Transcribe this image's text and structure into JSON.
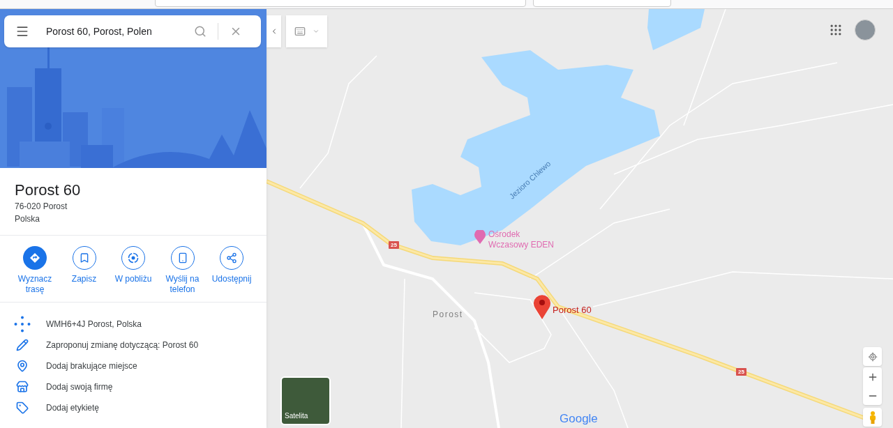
{
  "search": {
    "value": "Porost 60, Porost, Polen"
  },
  "place": {
    "title": "Porost 60",
    "address_lines": [
      "76-020 Porost",
      "Polska"
    ]
  },
  "actions": [
    {
      "label": "Wyznacz trasę",
      "kind": "route",
      "selected": true
    },
    {
      "label": "Zapisz",
      "kind": "save",
      "selected": false
    },
    {
      "label": "W pobliżu",
      "kind": "nearby",
      "selected": false
    },
    {
      "label": "Wyślij na telefon",
      "kind": "phone",
      "selected": false
    },
    {
      "label": "Udostępnij",
      "kind": "share",
      "selected": false
    }
  ],
  "details": [
    {
      "label": "WMH6+4J Porost, Polska",
      "kind": "pluscode"
    },
    {
      "label": "Zaproponuj zmianę dotyczącą: Porost 60",
      "kind": "edit"
    },
    {
      "label": "Dodaj brakujące miejsce",
      "kind": "addplace"
    },
    {
      "label": "Dodaj swoją firmę",
      "kind": "business"
    },
    {
      "label": "Dodaj etykietę",
      "kind": "label"
    }
  ],
  "map": {
    "lake_label": "Jezioro Chlewo",
    "poi_label": "Ośrodek Wczasowy EDEN",
    "village_label": "Porost",
    "pin_label": "Porost 60",
    "road_shields": [
      "25",
      "25"
    ],
    "logo": "Google",
    "layer_button": "Satelita"
  }
}
